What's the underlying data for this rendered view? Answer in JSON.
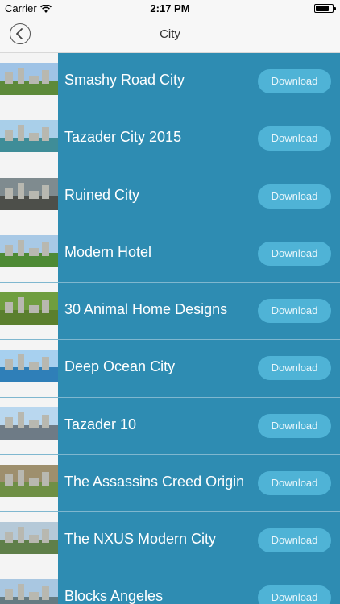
{
  "status_bar": {
    "carrier": "Carrier",
    "time": "2:17 PM"
  },
  "nav": {
    "title": "City"
  },
  "items": [
    {
      "title": "Smashy Road City",
      "button": "Download",
      "sky": "#9fc3e6",
      "ground": "#5d8a3a"
    },
    {
      "title": "Tazader City 2015",
      "button": "Download",
      "sky": "#a9cfe9",
      "ground": "#3f8d98"
    },
    {
      "title": "Ruined City",
      "button": "Download",
      "sky": "#7f8b8f",
      "ground": "#4d4f4a"
    },
    {
      "title": "Modern Hotel",
      "button": "Download",
      "sky": "#a8c9e6",
      "ground": "#4e8a35"
    },
    {
      "title": "30 Animal Home Designs",
      "button": "Download",
      "sky": "#6f9e3f",
      "ground": "#5b7f2e"
    },
    {
      "title": "Deep Ocean City",
      "button": "Download",
      "sky": "#a7d0ef",
      "ground": "#2f7fb8"
    },
    {
      "title": "Tazader 10",
      "button": "Download",
      "sky": "#b9d7ef",
      "ground": "#6e7b86"
    },
    {
      "title": "The Assassins Creed Origin",
      "button": "Download",
      "sky": "#9e8f6d",
      "ground": "#6f8f45"
    },
    {
      "title": "The NXUS Modern City",
      "button": "Download",
      "sky": "#b5c9d8",
      "ground": "#5f7f49"
    },
    {
      "title": "Blocks Angeles",
      "button": "Download",
      "sky": "#a9c7e1",
      "ground": "#657b82"
    }
  ]
}
